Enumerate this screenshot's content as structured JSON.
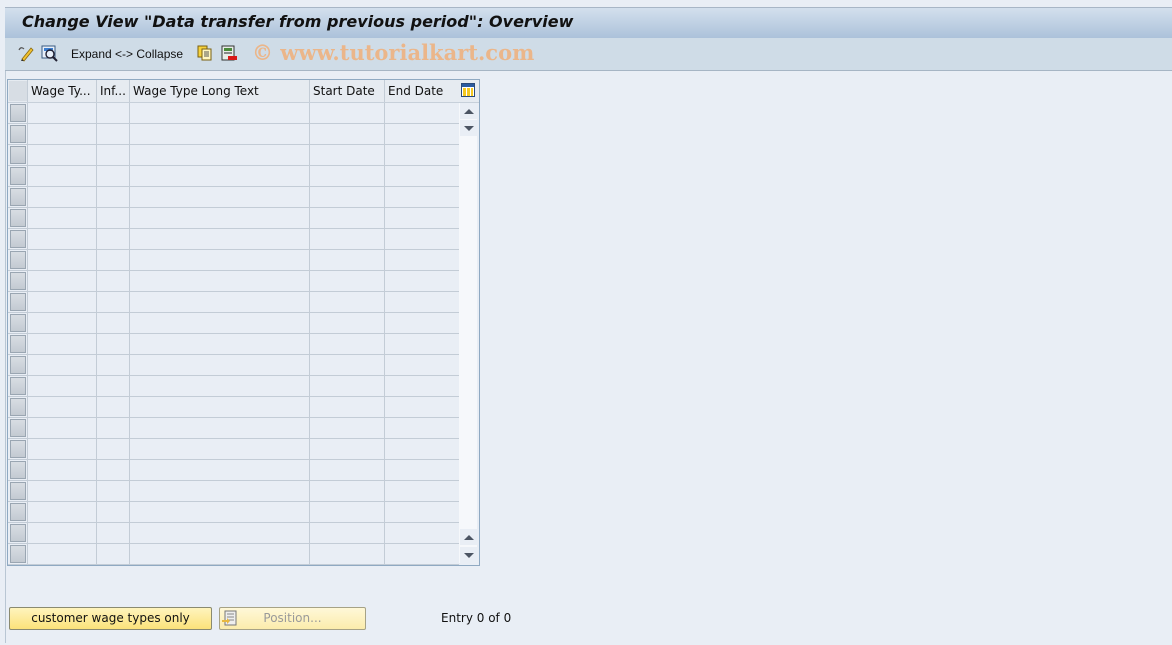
{
  "window": {
    "title": "Change View \"Data transfer from previous period\": Overview"
  },
  "toolbar": {
    "items": [
      {
        "name": "change-display-icon"
      },
      {
        "name": "find-icon"
      }
    ],
    "expand_collapse_label": "Expand <-> Collapse",
    "watermark": "© www.tutorialkart.com"
  },
  "table": {
    "columns": [
      {
        "label": "Wage Ty..."
      },
      {
        "label": "Inf..."
      },
      {
        "label": "Wage Type Long Text"
      },
      {
        "label": "Start Date"
      },
      {
        "label": "End Date"
      }
    ],
    "row_count": 22,
    "rows": []
  },
  "footer": {
    "customer_button_label": "customer wage types only",
    "position_button_label": "Position...",
    "entry_text": "Entry 0 of 0"
  },
  "colors": {
    "title_gradient_top": "#d3e0ed",
    "title_gradient_bottom": "#acc2da",
    "toolbar_bg": "#cfdce7",
    "background": "#e9eef5",
    "button_yellow": "#fbe27a"
  }
}
